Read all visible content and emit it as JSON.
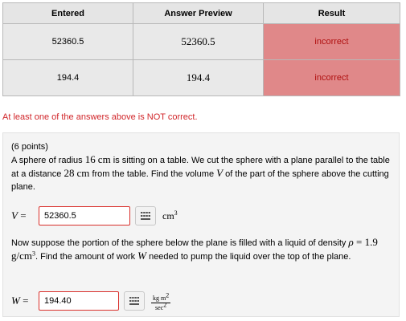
{
  "results": {
    "headers": [
      "Entered",
      "Answer Preview",
      "Result"
    ],
    "rows": [
      {
        "entered": "52360.5",
        "preview": "52360.5",
        "result": "incorrect"
      },
      {
        "entered": "194.4",
        "preview": "194.4",
        "result": "incorrect"
      }
    ]
  },
  "warning": "At least one of the answers above is NOT correct.",
  "problem": {
    "points": "(6 points)",
    "p1_a": "A sphere of radius ",
    "radius": "16",
    "unit_cm": "cm",
    "p1_b": " is sitting on a table. We cut the sphere with a plane parallel to the table at a distance ",
    "distance": "28",
    "p1_c": " from the table. Find the volume ",
    "var_v": "V",
    "p1_d": " of the part of the sphere above the cutting plane.",
    "answer1": {
      "label": "V =",
      "value": "52360.5",
      "unit": "cm",
      "unit_exp": "3"
    },
    "p2_a": "Now suppose the portion of the sphere below the plane is filled with a liquid of density ",
    "rho": "ρ = 1.9 g/cm",
    "rho_exp": "3",
    "p2_b": ". Find the amount of work ",
    "var_w": "W",
    "p2_c": " needed to pump the liquid over the top of the plane.",
    "answer2": {
      "label": "W =",
      "value": "194.40",
      "unit_num": "kg m",
      "unit_num_exp": "2",
      "unit_den": "sec",
      "unit_den_exp": "2"
    }
  },
  "icons": {
    "equation_editor": "grid-icon"
  },
  "colors": {
    "incorrect_bg": "#e08889",
    "incorrect_text": "#b01010",
    "warning": "#d1262a",
    "input_border": "#d9302c"
  }
}
